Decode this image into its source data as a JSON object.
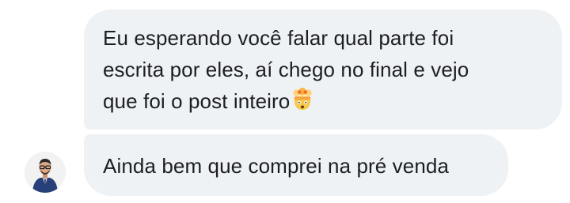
{
  "messages": [
    {
      "lines": [
        "Eu esperando você falar qual parte foi",
        "escrita por eles, aí chego no final e vejo",
        "que foi o post inteiro"
      ],
      "emoji": "🤯",
      "emoji_icon": "exploding-head-emoji"
    },
    {
      "lines": [
        "Ainda bem que comprei na pré venda"
      ]
    }
  ],
  "sender": {
    "avatar_icon": "user-avatar"
  },
  "colors": {
    "bubble_bg": "#eff2f5",
    "text": "#1c1e21",
    "background": "#ffffff"
  }
}
